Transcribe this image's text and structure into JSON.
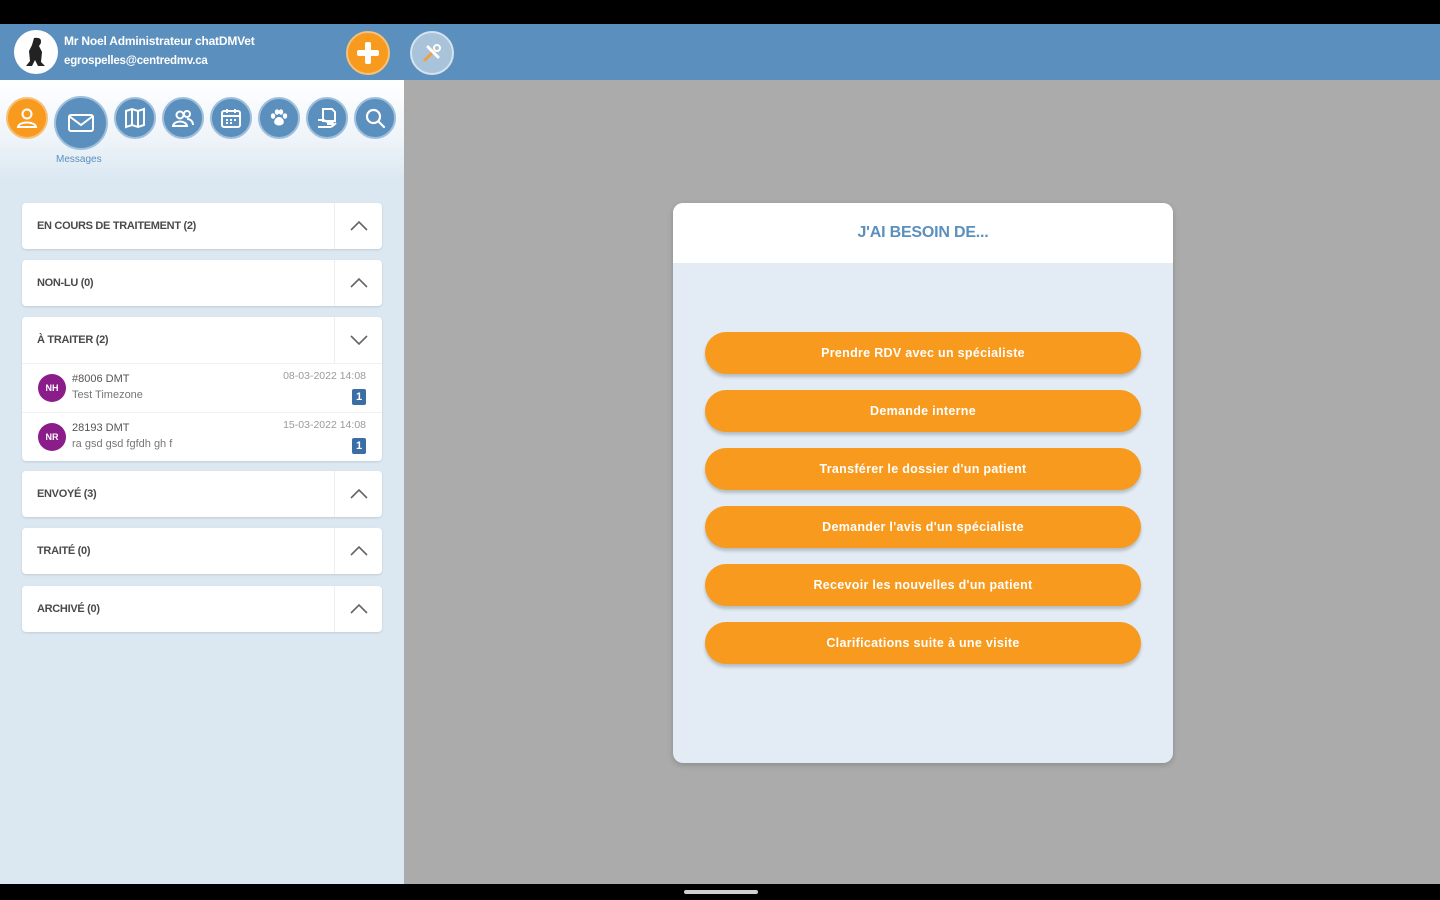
{
  "header": {
    "user_name": "Mr Noel Administrateur chatDMVet",
    "user_email": "egrospelles@centredmv.ca",
    "add_icon": "plus-icon",
    "tools_icon": "tools-icon"
  },
  "nav": {
    "items": [
      {
        "icon": "user-icon"
      },
      {
        "icon": "envelope-icon",
        "label": "Messages"
      },
      {
        "icon": "map-icon"
      },
      {
        "icon": "users-icon"
      },
      {
        "icon": "calendar-icon"
      },
      {
        "icon": "paw-icon"
      },
      {
        "icon": "document-hand-icon"
      },
      {
        "icon": "search-icon"
      }
    ]
  },
  "sections": [
    {
      "title": "EN COURS DE TRAITEMENT (2)",
      "expanded": false
    },
    {
      "title": "NON-LU (0)",
      "expanded": false
    },
    {
      "title": "À TRAITER (2)",
      "expanded": true,
      "messages": [
        {
          "initials": "NH",
          "ref": "#8006 DMT",
          "subject": "Test Timezone",
          "date": "08-03-2022 14:08",
          "count": "1"
        },
        {
          "initials": "NR",
          "ref": "28193 DMT",
          "subject": "ra gsd gsd fgfdh gh f",
          "date": "15-03-2022 14:08",
          "count": "1"
        }
      ]
    },
    {
      "title": "ENVOYÉ (3)",
      "expanded": false
    },
    {
      "title": "TRAITÉ (0)",
      "expanded": false
    },
    {
      "title": "ARCHIVÉ (0)",
      "expanded": false
    }
  ],
  "dialog": {
    "title": "J'AI BESOIN DE...",
    "actions": [
      "Prendre RDV avec un spécialiste",
      "Demande interne",
      "Transférer le dossier d'un patient",
      "Demander l'avis d'un spécialiste",
      "Recevoir les nouvelles d'un patient",
      "Clarifications suite à une visite"
    ]
  },
  "colors": {
    "brand_blue": "#5b8fbd",
    "accent_orange": "#f79a1e",
    "avatar_purple": "#8a1d8a"
  }
}
